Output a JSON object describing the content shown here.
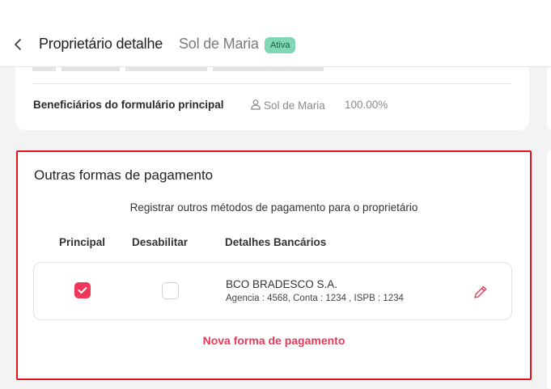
{
  "header": {
    "title": "Proprietário detalhe",
    "subtitle": "Sol de Maria",
    "status": "Ativa"
  },
  "beneficiaries": {
    "label": "Beneficiários do formulário principal",
    "user": "Sol de Maria",
    "percent": "100.00%"
  },
  "payment": {
    "title": "Outras formas de pagamento",
    "description": "Registrar outros métodos de pagamento para o proprietário",
    "columns": {
      "principal": "Principal",
      "disable": "Desabilitar",
      "details": "Detalhes Bancários"
    },
    "rows": [
      {
        "principal": true,
        "disabled": false,
        "bank": "BCO BRADESCO S.A.",
        "details": "Agencia : 4568, Conta : 1234 , ISPB : 1234"
      }
    ],
    "add_label": "Nova forma de pagamento"
  },
  "colors": {
    "accent": "#f0375a",
    "highlight_border": "#e0141f",
    "badge_bg": "#7fd7b3"
  }
}
